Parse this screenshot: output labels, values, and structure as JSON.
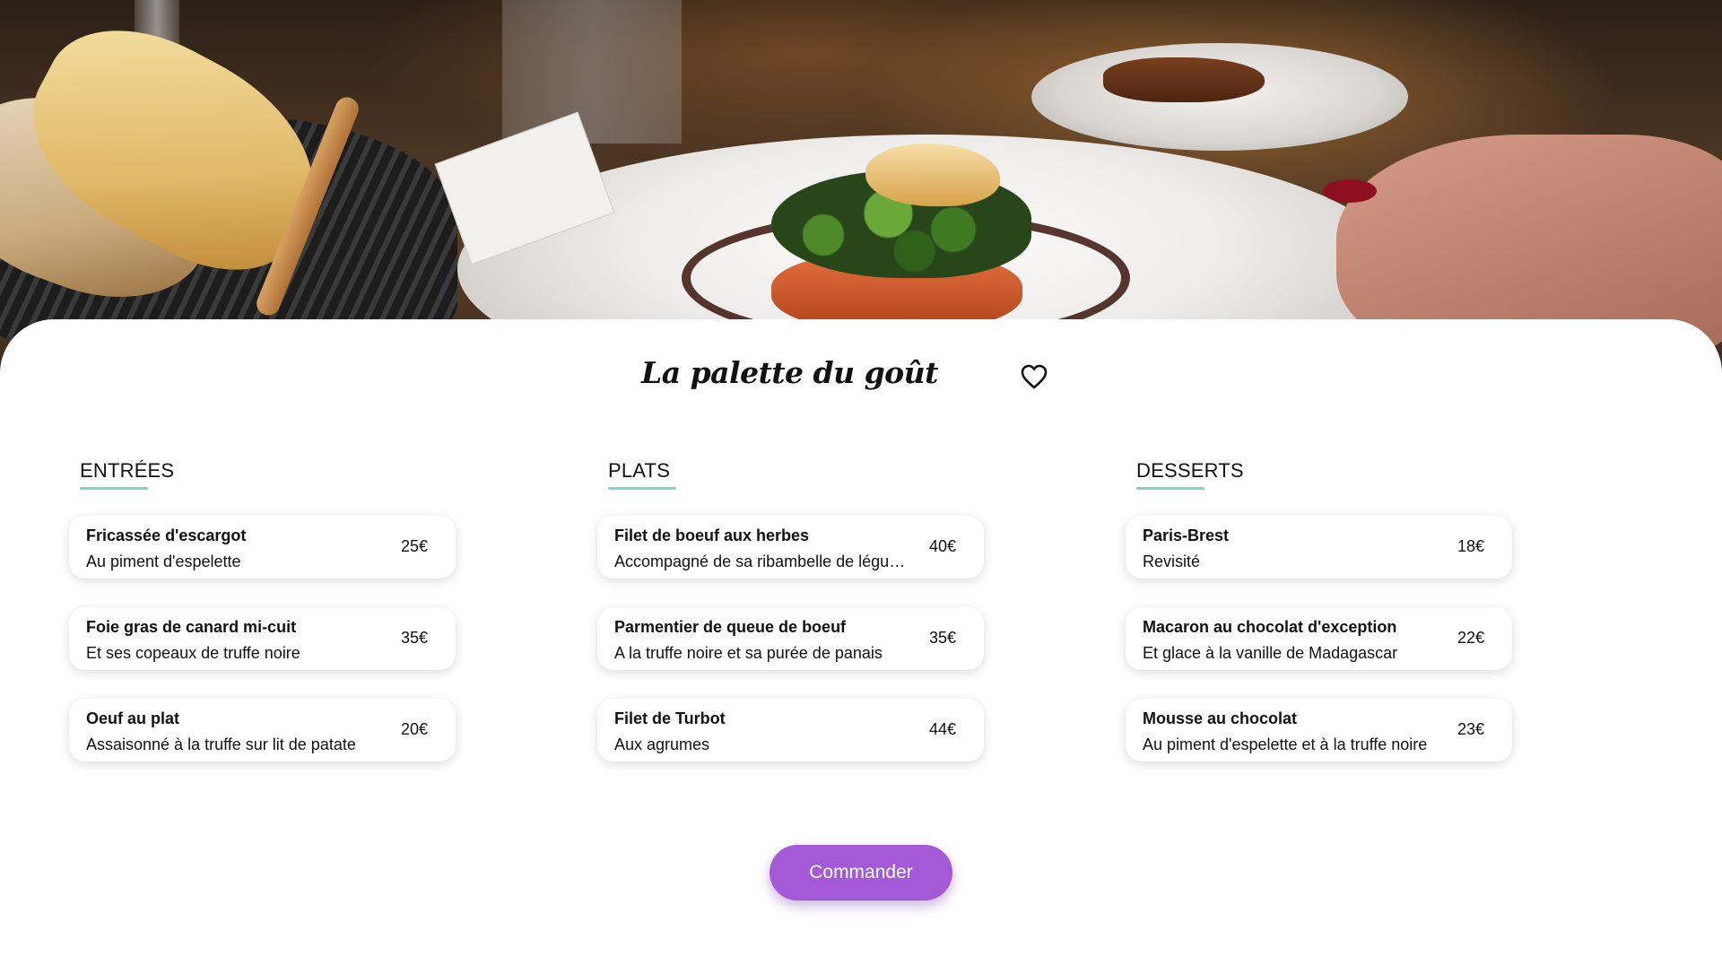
{
  "restaurant": {
    "title": "La palette du goût"
  },
  "colors": {
    "accent": "#a459d6",
    "underline": "#7fd3c4",
    "background": "#ffffff"
  },
  "icons": {
    "favorite": "heart-outline-icon"
  },
  "menu": {
    "columns": [
      {
        "heading": "ENTRÉES",
        "items": [
          {
            "name": "Fricassée d'escargot",
            "description": "Au piment d'espelette",
            "price": "25€"
          },
          {
            "name": "Foie gras de canard mi-cuit",
            "description": "Et ses copeaux de truffe noire",
            "price": "35€"
          },
          {
            "name": "Oeuf au plat",
            "description": "Assaisonné à la truffe sur lit de patate",
            "price": "20€"
          }
        ]
      },
      {
        "heading": "PLATS",
        "items": [
          {
            "name": "Filet de boeuf aux herbes",
            "description": "Accompagné de sa ribambelle de légumes",
            "price": "40€"
          },
          {
            "name": "Parmentier de queue de boeuf",
            "description": "A la truffe noire et sa purée de panais",
            "price": "35€"
          },
          {
            "name": "Filet de Turbot",
            "description": "Aux agrumes",
            "price": "44€"
          }
        ]
      },
      {
        "heading": "DESSERTS",
        "items": [
          {
            "name": "Paris-Brest",
            "description": "Revisité",
            "price": "18€"
          },
          {
            "name": "Macaron au chocolat d'exception",
            "description": "Et glace à la vanille de Madagascar",
            "price": "22€"
          },
          {
            "name": "Mousse au chocolat",
            "description": "Au piment d'espelette et à la truffe noire",
            "price": "23€"
          }
        ]
      }
    ]
  },
  "actions": {
    "order_label": "Commander"
  }
}
